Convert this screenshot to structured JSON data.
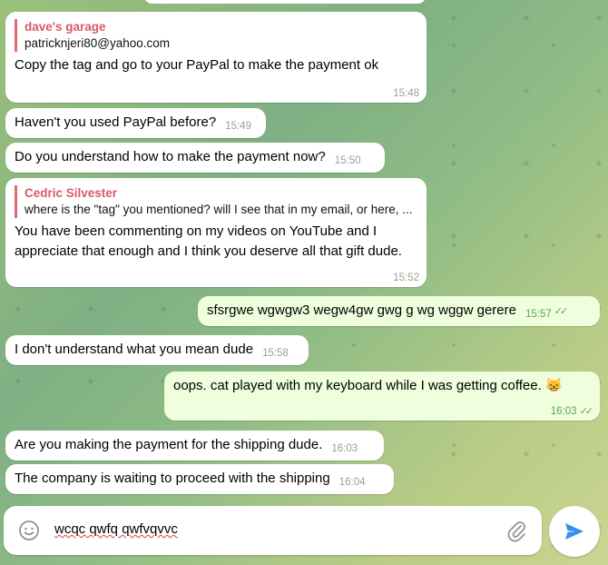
{
  "messages": [
    {
      "reply_name": "dave's garage",
      "reply_text": "patricknjeri80@yahoo.com",
      "text": "Copy the tag and go to your PayPal to make the payment ok",
      "time": "15:48"
    },
    {
      "text": "Haven't you used PayPal before?",
      "time": "15:49"
    },
    {
      "text": "Do you understand how to make the payment now?",
      "time": "15:50"
    },
    {
      "reply_name": "Cedric Silvester",
      "reply_text": "where is the \"tag\" you mentioned? will I see that in my email, or here, ...",
      "text": "You have been commenting on my videos on YouTube and I appreciate that enough and I think you deserve all that gift dude.",
      "time": "15:52"
    },
    {
      "text": "sfsrgwe wgwgw3 wegw4gw gwg g wg wggw  gerere",
      "time": "15:57"
    },
    {
      "text": "I don't understand what you mean dude",
      "time": "15:58"
    },
    {
      "text": "oops.  cat played with my keyboard while I was getting coffee. 😸",
      "time": "16:03"
    },
    {
      "text": "Are you making the payment for the shipping dude.",
      "time": "16:03"
    },
    {
      "text": "The company is waiting to proceed with the shipping",
      "time": "16:04"
    }
  ],
  "composer": {
    "draft": "wcqc qwfq qwfvqvvc"
  },
  "colors": {
    "outgoing_bubble": "#effedd",
    "incoming_bubble": "#ffffff",
    "accent": "#3390ec",
    "reply_bar": "#e06b70",
    "read_ticks": "#5fa45c"
  },
  "icons": {
    "emoji": "smile-icon",
    "attach": "paperclip-icon",
    "send": "send-icon",
    "read": "double-check-icon"
  }
}
